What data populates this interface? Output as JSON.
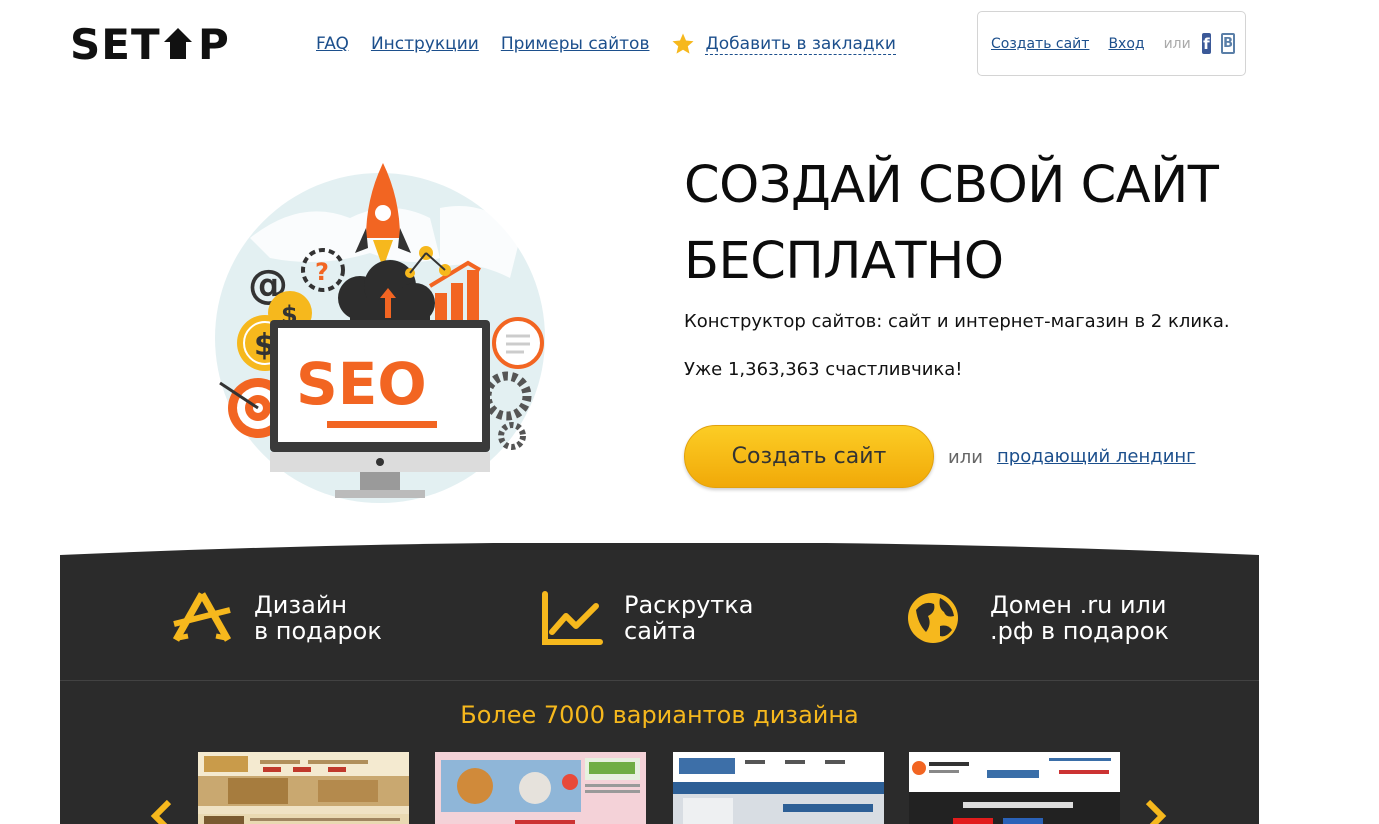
{
  "header": {
    "logo": "SETUP",
    "nav": [
      {
        "label": "FAQ"
      },
      {
        "label": "Инструкции"
      },
      {
        "label": "Примеры сайтов"
      }
    ],
    "bookmark_label": "Добавить в закладки",
    "auth": {
      "create_label": "Создать сайт",
      "login_label": "Вход",
      "or_label": "или",
      "fb_icon": "facebook-icon",
      "vk_icon": "vk-icon",
      "fb_glyph": "f",
      "vk_glyph": "B"
    }
  },
  "hero": {
    "title_line1": "СОЗДАЙ СВОЙ САЙТ",
    "title_line2": "БЕСПЛАТНО",
    "subtitle": "Конструктор сайтов: сайт и интернет-магазин в 2 клика.",
    "counter": "Уже 1,363,363 счастливчика!",
    "cta_label": "Создать сайт",
    "cta_or": "или",
    "cta_link": "продающий лендинг",
    "illustration_text": "SEO"
  },
  "features": [
    {
      "text": "Дизайн\nв подарок",
      "icon": "design-tools-icon"
    },
    {
      "text": "Раскрутка\nсайта",
      "icon": "growth-chart-icon"
    },
    {
      "text": "Домен .ru или\n.рф в подарок",
      "icon": "globe-icon"
    }
  ],
  "designs": {
    "title": "Более 7000 вариантов дизайна"
  },
  "colors": {
    "accent": "#f6b81d",
    "link": "#1c4f8c",
    "dark_bg": "#2b2b2b",
    "seo_orange": "#f26522"
  }
}
